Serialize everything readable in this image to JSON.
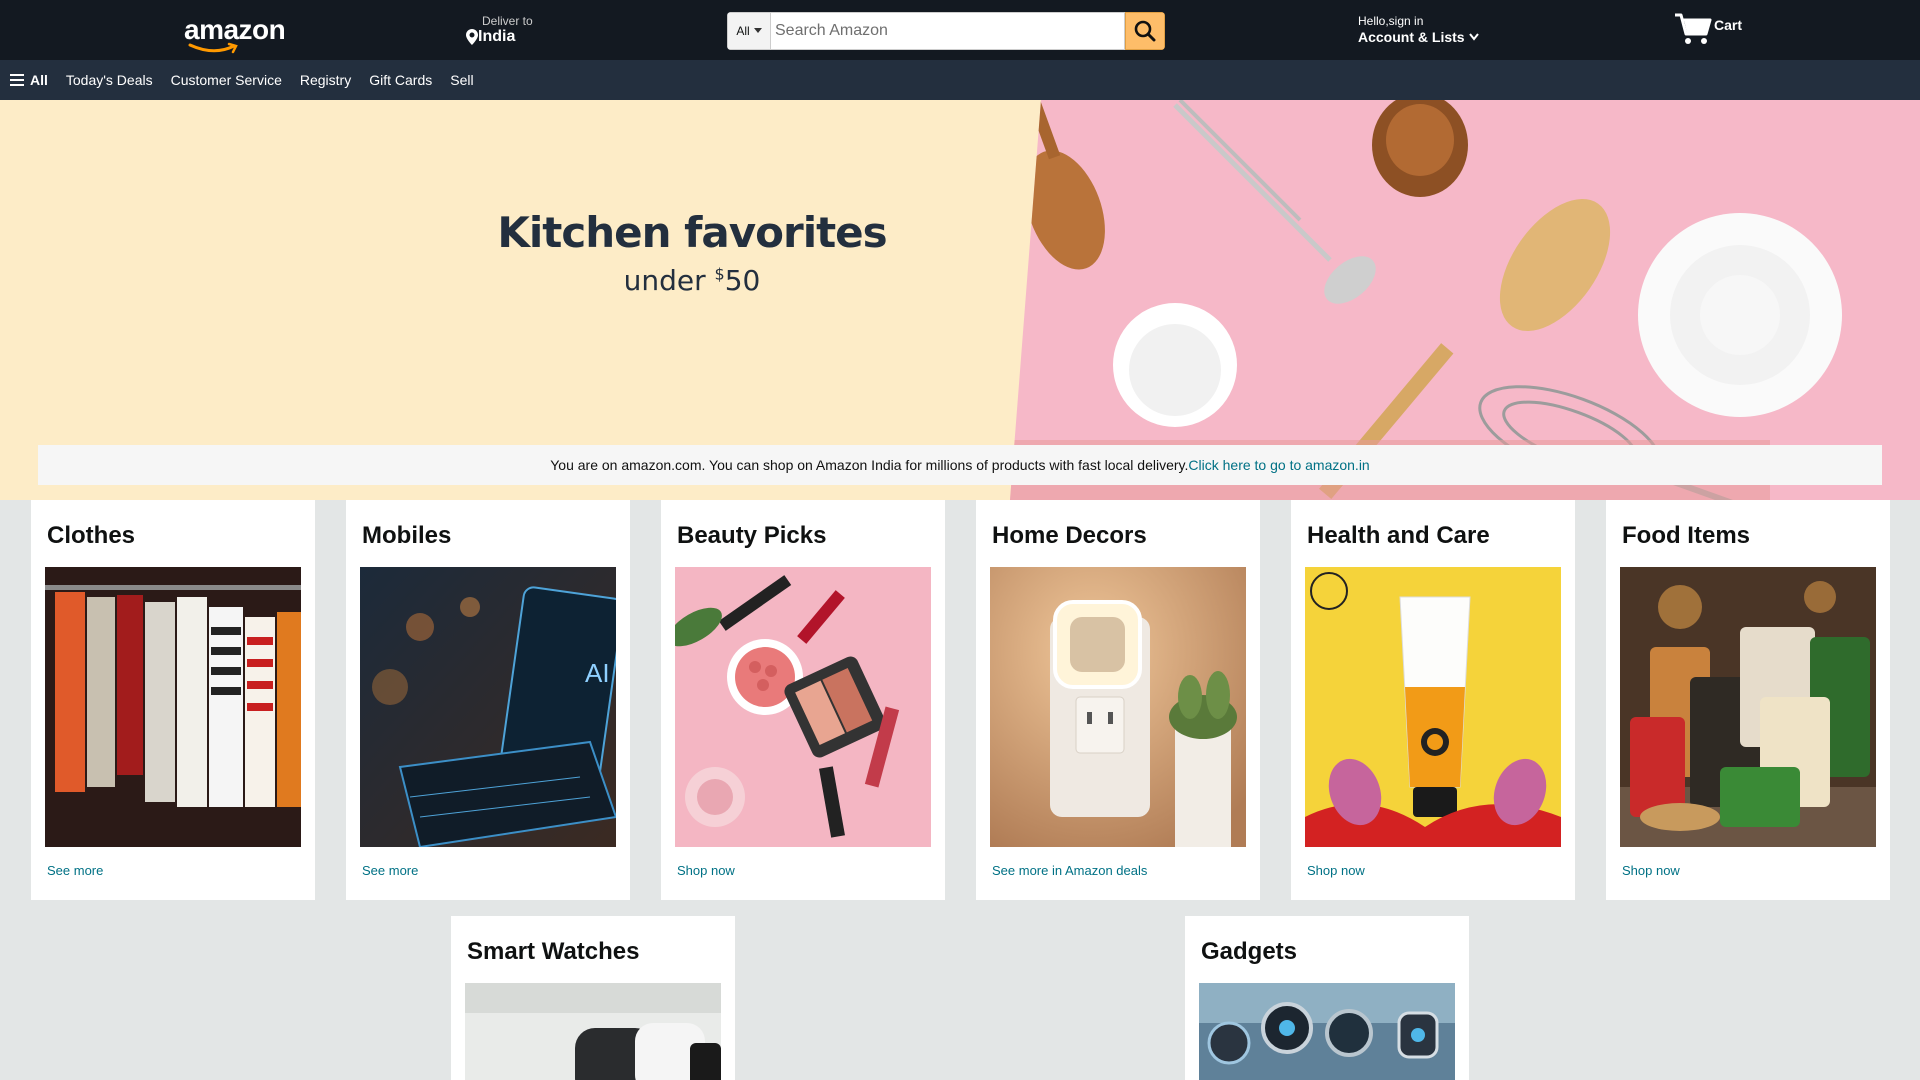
{
  "header": {
    "logo": "amazon",
    "deliver_label": "Deliver to",
    "deliver_location": "India",
    "search_category": "All",
    "search_placeholder": "Search Amazon",
    "account_greeting": "Hello,sign in",
    "account_label": "Account & Lists",
    "cart_label": "Cart"
  },
  "subnav": {
    "all_label": "All",
    "items": [
      "Today's Deals",
      "Customer Service",
      "Registry",
      "Gift Cards",
      "Sell"
    ]
  },
  "hero": {
    "title": "Kitchen favorites",
    "subtitle_prefix": "under ",
    "subtitle_currency": "$",
    "subtitle_amount": "50"
  },
  "notice": {
    "text": "You are on amazon.com. You can shop on Amazon India for millions of products with fast local delivery.",
    "link": "Click here to go to amazon.in"
  },
  "cards": [
    {
      "title": "Clothes",
      "link": "See more"
    },
    {
      "title": "Mobiles",
      "link": "See more"
    },
    {
      "title": "Beauty Picks",
      "link": "Shop now"
    },
    {
      "title": "Home Decors",
      "link": "See more in Amazon deals"
    },
    {
      "title": "Health and Care",
      "link": "Shop now"
    },
    {
      "title": "Food Items",
      "link": "Shop now"
    },
    {
      "title": "Smart Watches",
      "link": ""
    },
    {
      "title": "Gadgets",
      "link": ""
    }
  ],
  "colors": {
    "nav_bg": "#131921",
    "subnav_bg": "#232f3e",
    "search_button": "#febd69",
    "link": "#007185",
    "page_bg": "#e3e6e6"
  }
}
